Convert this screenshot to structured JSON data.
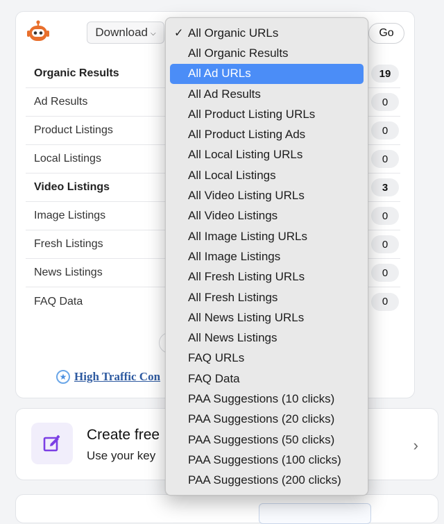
{
  "toolbar": {
    "download_label": "Download",
    "go_label": "Go"
  },
  "results": [
    {
      "label": "Organic Results",
      "count": "19",
      "bold": true
    },
    {
      "label": "Ad Results",
      "count": "0",
      "bold": false
    },
    {
      "label": "Product Listings",
      "count": "0",
      "bold": false
    },
    {
      "label": "Local Listings",
      "count": "0",
      "bold": false
    },
    {
      "label": "Video Listings",
      "count": "3",
      "bold": true
    },
    {
      "label": "Image Listings",
      "count": "0",
      "bold": false
    },
    {
      "label": "Fresh Listings",
      "count": "0",
      "bold": false
    },
    {
      "label": "News Listings",
      "count": "0",
      "bold": false
    },
    {
      "label": "FAQ Data",
      "count": "0",
      "bold": false
    }
  ],
  "high_traffic_link": "High Traffic Con",
  "create_card": {
    "title": "Create free",
    "subtitle": "Use your key"
  },
  "dropdown": {
    "selected": "All Organic URLs",
    "highlighted": "All Ad URLs",
    "options": [
      "All Organic URLs",
      "All Organic Results",
      "All Ad URLs",
      "All Ad Results",
      "All Product Listing URLs",
      "All Product Listing Ads",
      "All Local Listing URLs",
      "All Local Listings",
      "All Video Listing URLs",
      "All Video Listings",
      "All Image Listing URLs",
      "All Image Listings",
      "All Fresh Listing URLs",
      "All Fresh Listings",
      "All News Listing URLs",
      "All News Listings",
      "FAQ URLs",
      "FAQ Data",
      "PAA Suggestions (10 clicks)",
      "PAA Suggestions (20 clicks)",
      "PAA Suggestions (50 clicks)",
      "PAA Suggestions (100 clicks)",
      "PAA Suggestions (200 clicks)"
    ]
  },
  "colors": {
    "accent_highlight": "#4b8df7",
    "robot_orange": "#e86f2c",
    "pen_purple": "#7b3fe4",
    "link_blue": "#2e5aa0"
  },
  "icons": {
    "robot": "robot-icon",
    "download_chevron": "chevron-down-icon",
    "star": "star-icon",
    "pen": "edit-pen-icon",
    "create_chevron": "chevron-right-icon",
    "check": "checkmark-icon"
  }
}
